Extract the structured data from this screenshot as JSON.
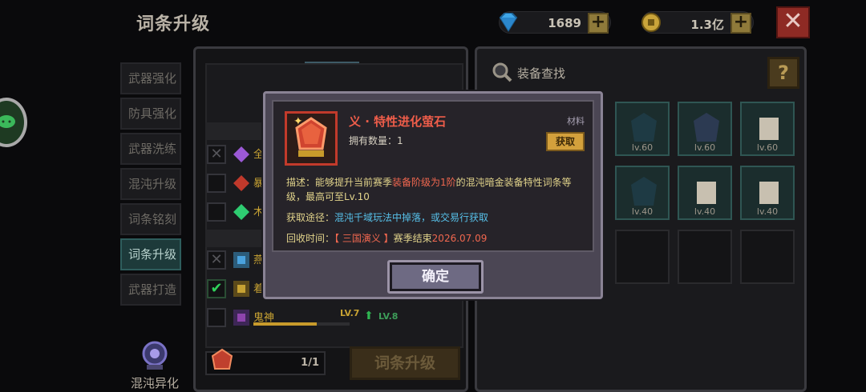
{
  "header": {
    "title": "词条升级",
    "gem_amount": "1689",
    "coin_amount": "1.3亿",
    "plus_label": "+",
    "close_label": "✕"
  },
  "side_tabs": [
    {
      "label": "武器强化"
    },
    {
      "label": "防具强化"
    },
    {
      "label": "武器洗练"
    },
    {
      "label": "混沌升级"
    },
    {
      "label": "词条铭刻"
    },
    {
      "label": "词条升级"
    },
    {
      "label": "武器打造"
    }
  ],
  "active_tab": "词条升级",
  "chaos_mutation_label": "混沌异化",
  "left_panel": {
    "rows": [
      {
        "name": "全",
        "checked": "x",
        "color": "#9b59d6"
      },
      {
        "name": "暴",
        "checked": "none",
        "color": "#c0392b"
      },
      {
        "name": "木",
        "checked": "none",
        "color": "#2ecc71"
      },
      {
        "name": "燕",
        "checked": "x",
        "color": "#4aa3df"
      },
      {
        "name": "着",
        "checked": "on",
        "color": "#c7a233"
      },
      {
        "name": "鬼神",
        "checked": "none",
        "color": "#8e44ad"
      }
    ],
    "last_row_level": "LV.7",
    "last_row_next_level": "LV.8",
    "last_row_progress": 0.66,
    "material_count": "1/1",
    "upgrade_button": "词条升级"
  },
  "right_panel": {
    "search_label": "装备查找",
    "help_label": "?",
    "slots": [
      {
        "level": "lv.60",
        "filled": true
      },
      {
        "level": "lv.60",
        "filled": true
      },
      {
        "level": "lv.60",
        "filled": true
      },
      {
        "level": "lv.40",
        "filled": true
      },
      {
        "level": "lv.40",
        "filled": true
      },
      {
        "level": "lv.40",
        "filled": true
      },
      {
        "level": "",
        "filled": false
      },
      {
        "level": "",
        "filled": false
      },
      {
        "level": "",
        "filled": false
      }
    ]
  },
  "modal": {
    "item_name": "义 · 特性进化萤石",
    "item_type": "材料",
    "owned_label": "拥有数量：1",
    "get_button": "获取",
    "desc_prefix": "描述：能够提升当前赛季",
    "desc_highlight": "装备阶级为1阶",
    "desc_suffix": "的混沌暗金装备特性词条等级，最高可至Lv.10",
    "source_prefix": "获取途径：",
    "source_text": "混沌千域玩法中掉落，或交易行获取",
    "recycle_prefix": "回收时间：",
    "recycle_season": "【 三国演义 】",
    "recycle_mid": "赛季结束",
    "recycle_date": "2026.07.09",
    "confirm_button": "确定"
  },
  "colors": {
    "accent_red": "#ef5d4a",
    "text_gold": "#e1d38b",
    "text_blue": "#57c1ea",
    "active_tab": "#1d3a3a"
  }
}
